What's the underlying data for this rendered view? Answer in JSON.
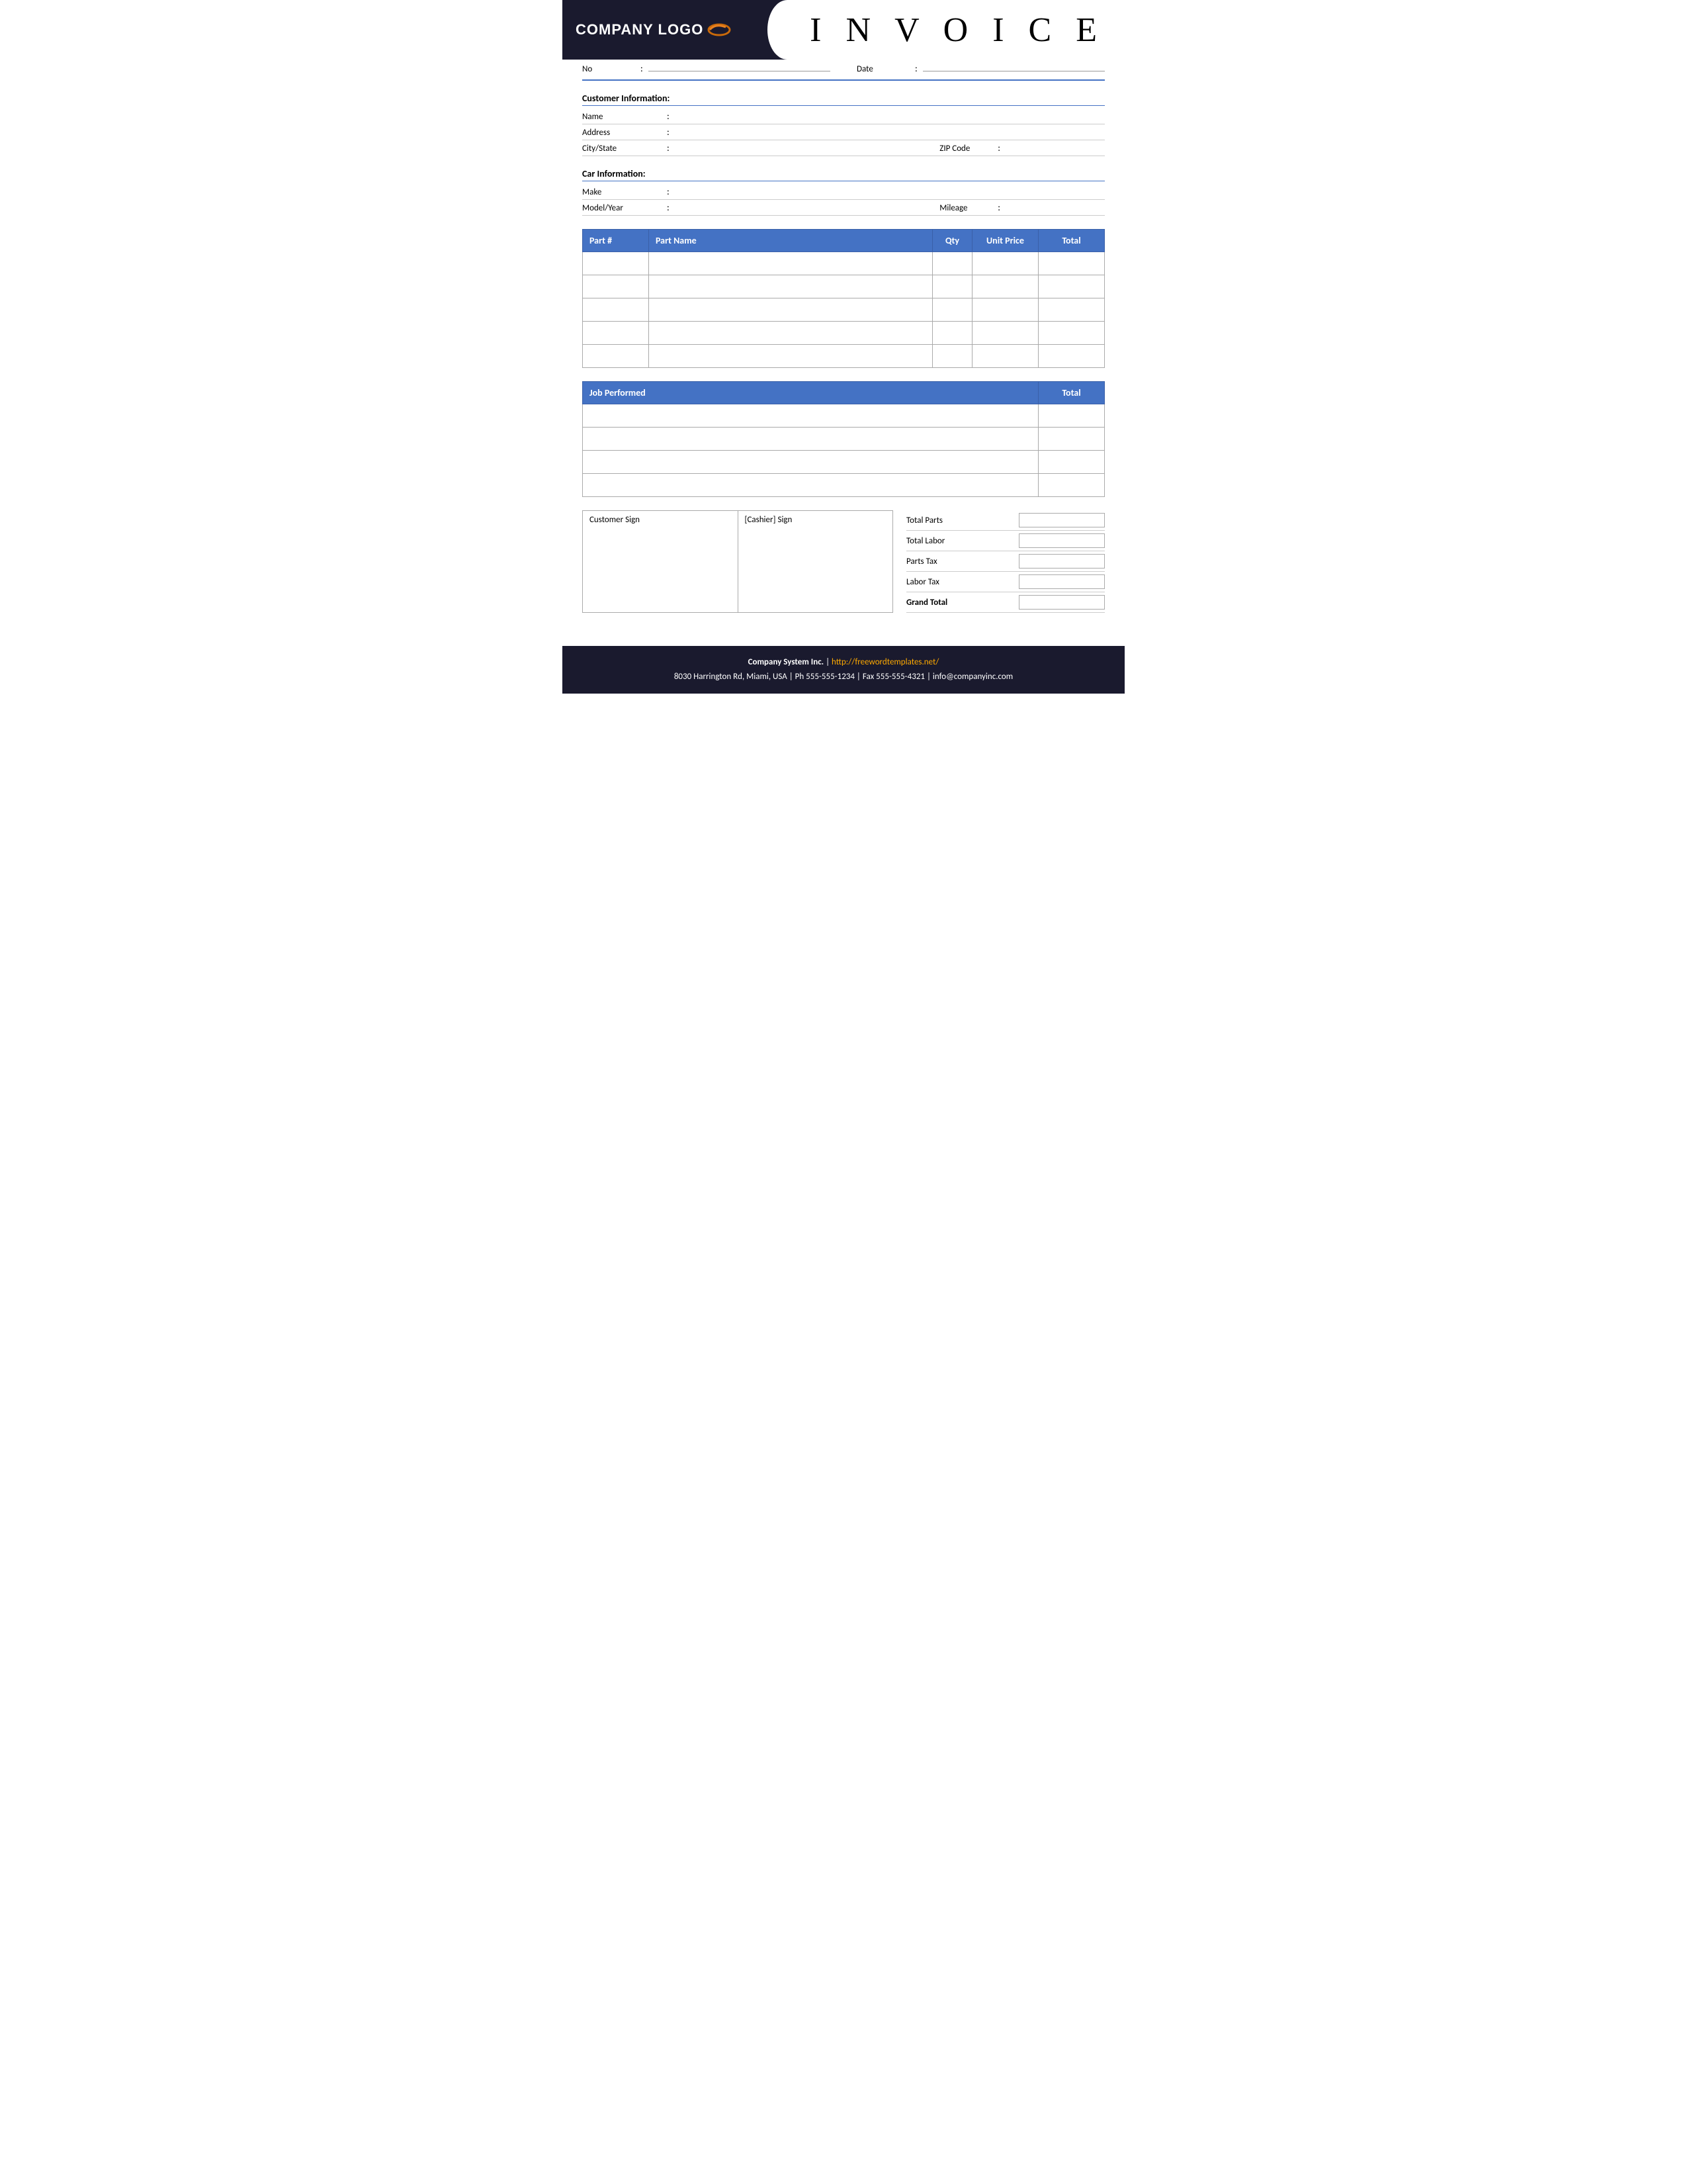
{
  "header": {
    "logo_text": "COMPANY LOGO",
    "invoice_title": "I N V O I C E"
  },
  "meta": {
    "no_label": "No",
    "no_colon": ":",
    "date_label": "Date",
    "date_colon": ":"
  },
  "customer_info": {
    "section_title": "Customer Information:",
    "name_label": "Name",
    "name_colon": ":",
    "address_label": "Address",
    "address_colon": ":",
    "city_state_label": "City/State",
    "city_state_colon": ":",
    "zip_label": "ZIP Code",
    "zip_colon": ":"
  },
  "car_info": {
    "section_title": "Car Information:",
    "make_label": "Make",
    "make_colon": ":",
    "model_year_label": "Model/Year",
    "model_year_colon": ":",
    "mileage_label": "Mileage",
    "mileage_colon": ":"
  },
  "parts_table": {
    "col_part": "Part #",
    "col_name": "Part Name",
    "col_qty": "Qty",
    "col_price": "Unit Price",
    "col_total": "Total",
    "rows": [
      {
        "part": "",
        "name": "",
        "qty": "",
        "price": "",
        "total": ""
      },
      {
        "part": "",
        "name": "",
        "qty": "",
        "price": "",
        "total": ""
      },
      {
        "part": "",
        "name": "",
        "qty": "",
        "price": "",
        "total": ""
      },
      {
        "part": "",
        "name": "",
        "qty": "",
        "price": "",
        "total": ""
      },
      {
        "part": "",
        "name": "",
        "qty": "",
        "price": "",
        "total": ""
      }
    ]
  },
  "job_table": {
    "col_job": "Job Performed",
    "col_total": "Total",
    "rows": [
      {
        "job": "",
        "total": ""
      },
      {
        "job": "",
        "total": ""
      },
      {
        "job": "",
        "total": ""
      },
      {
        "job": "",
        "total": ""
      }
    ]
  },
  "signatures": {
    "customer_sign_label": "Customer Sign",
    "cashier_sign_label": "[Cashier] Sign"
  },
  "totals": {
    "total_parts_label": "Total Parts",
    "total_labor_label": "Total Labor",
    "parts_tax_label": "Parts Tax",
    "labor_tax_label": "Labor Tax",
    "grand_total_label": "Grand Total"
  },
  "footer": {
    "company_name": "Company System Inc.",
    "separator": "|",
    "website_label": "http://freewordtemplates.net/",
    "address_line": "8030 Harrington Rd, Miami, USA | Ph 555-555-1234 | Fax 555-555-4321 | info@companyinc.com"
  }
}
